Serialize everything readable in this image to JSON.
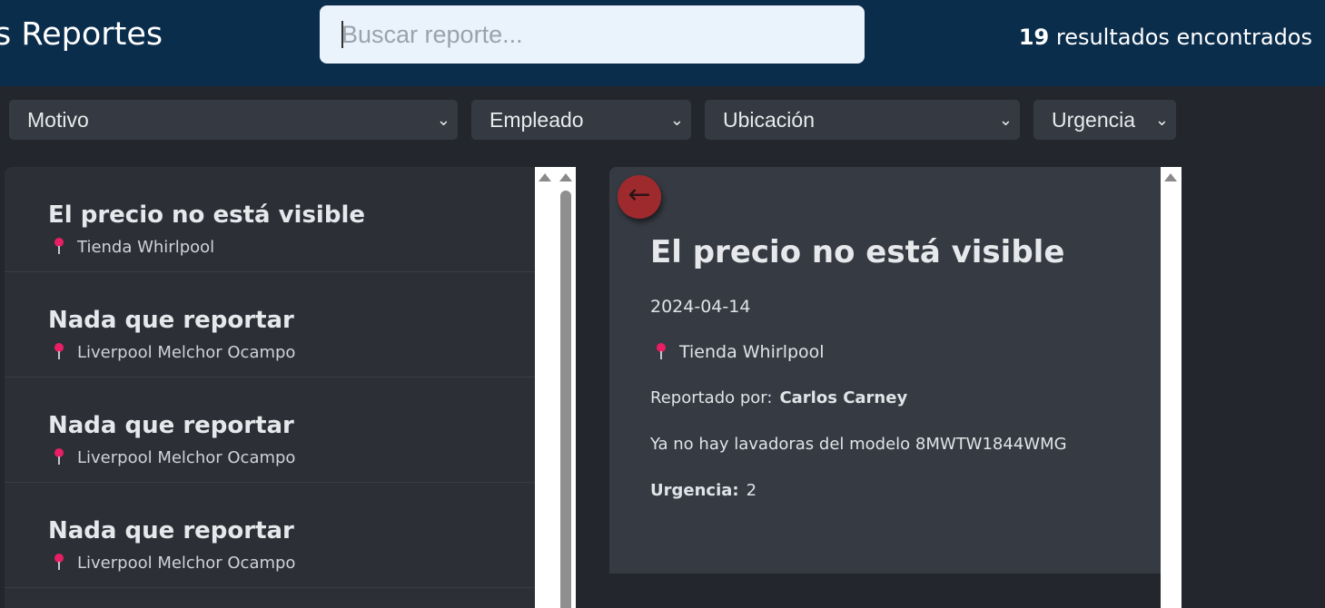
{
  "header": {
    "title": "s Reportes",
    "search_placeholder": "Buscar reporte...",
    "results_count": "19",
    "results_label": " resultados encontrados"
  },
  "filters": [
    {
      "label": "Motivo"
    },
    {
      "label": "Empleado"
    },
    {
      "label": "Ubicación"
    },
    {
      "label": "Urgencia"
    }
  ],
  "list": [
    {
      "title": "El precio no está visible",
      "location": "Tienda Whirlpool"
    },
    {
      "title": "Nada que reportar",
      "location": "Liverpool Melchor Ocampo"
    },
    {
      "title": "Nada que reportar",
      "location": "Liverpool Melchor Ocampo"
    },
    {
      "title": "Nada que reportar",
      "location": "Liverpool Melchor Ocampo"
    }
  ],
  "detail": {
    "back_icon": "←",
    "title": "El precio no está visible",
    "date": "2024-04-14",
    "location": "Tienda Whirlpool",
    "reported_by_label": "Reportado por:",
    "reported_by": "Carlos Carney",
    "description": "Ya no hay lavadoras del modelo 8MWTW1844WMG",
    "urgency_label": "Urgencia:",
    "urgency": "2"
  },
  "colors": {
    "header_bg": "#0b2d4c",
    "page_bg": "#23272d",
    "panel_bg": "#2c3036",
    "card_bg": "#363a42",
    "back_button": "#9e2a2e",
    "pin": "#e91e63"
  }
}
